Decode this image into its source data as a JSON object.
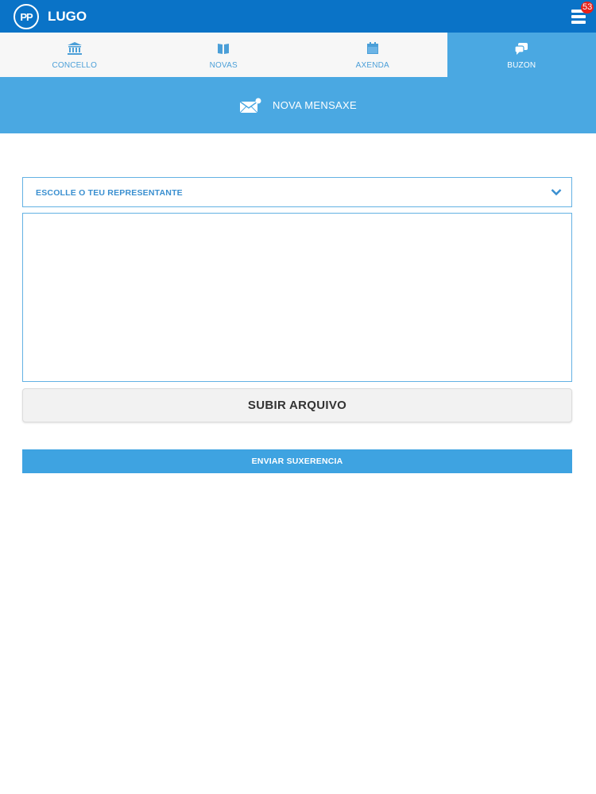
{
  "header": {
    "logo_text": "PP",
    "title": "LUGO",
    "notification_count": "53"
  },
  "tabs": [
    {
      "label": "CONCELLO",
      "icon": "building-icon",
      "active": false
    },
    {
      "label": "NOVAS",
      "icon": "book-icon",
      "active": false
    },
    {
      "label": "AXENDA",
      "icon": "calendar-icon",
      "active": false
    },
    {
      "label": "BUZON",
      "icon": "chat-icon",
      "active": true
    }
  ],
  "banner": {
    "label": "NOVA MENSAXE",
    "icon": "envelope-icon"
  },
  "form": {
    "select_label": "ESCOLLE O TEU REPRESENTANTE",
    "message_value": "",
    "upload_label": "SUBIR ARQUIVO",
    "send_label": "ENVIAR SUXERENCIA"
  },
  "colors": {
    "topbar": "#0a73c7",
    "accent": "#4aa8e2",
    "send_button": "#3ea3e1",
    "badge": "#e8221b"
  }
}
